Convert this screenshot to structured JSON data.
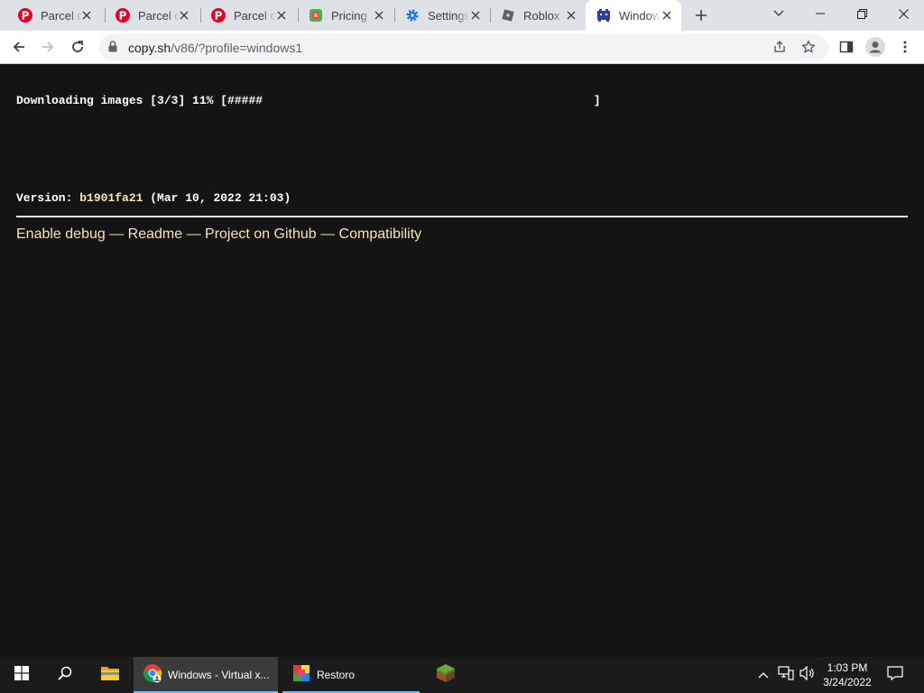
{
  "browser": {
    "tabs": [
      {
        "title": "Parcel d",
        "icon": "pinterest-icon"
      },
      {
        "title": "Parcel d",
        "icon": "pinterest-icon"
      },
      {
        "title": "Parcel d",
        "icon": "pinterest-icon"
      },
      {
        "title": "Pricing",
        "icon": "pricing-app-icon"
      },
      {
        "title": "Settings",
        "icon": "gear-icon"
      },
      {
        "title": "Roblox",
        "icon": "roblox-icon"
      },
      {
        "title": "Window",
        "icon": "v86-icon",
        "active": true
      }
    ],
    "url_host": "copy.sh",
    "url_path": "/v86/?profile=windows1"
  },
  "page": {
    "progress_line": "Downloading images [3/3] 11% [#####                                               ]",
    "download_progress_percent": 11,
    "version_label": "Version: ",
    "version_hash": "b1901fa21",
    "version_date": " (Mar 10, 2022 21:03)",
    "links": [
      "Enable debug",
      "Readme",
      "Project on Github",
      "Compatibility"
    ],
    "link_separator": " — "
  },
  "taskbar": {
    "apps": [
      {
        "label": "Windows - Virtual x...",
        "icon": "chrome-icon",
        "active": true
      },
      {
        "label": "Restoro",
        "icon": "restoro-icon"
      }
    ],
    "time": "1:03 PM",
    "date": "3/24/2022"
  },
  "colors": {
    "page_bg": "#141414",
    "link": "#f7e4b9",
    "tabstrip": "#dee1e6",
    "taskbar": "#1b1b1b"
  }
}
